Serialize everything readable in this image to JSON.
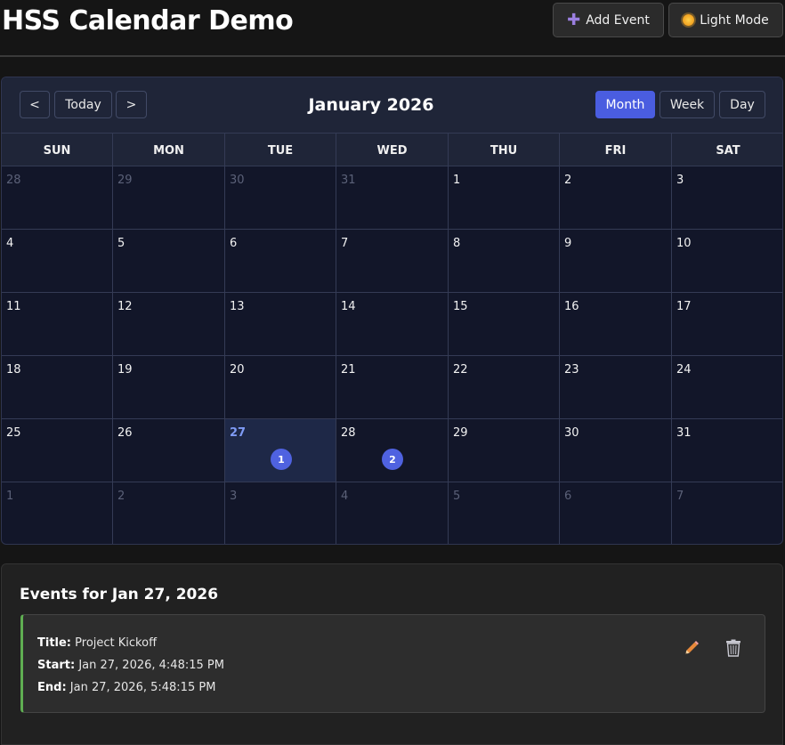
{
  "header": {
    "title": "HSS Calendar Demo",
    "add_event_label": "Add Event",
    "theme_label": "Light Mode"
  },
  "toolbar": {
    "prev_label": "<",
    "today_label": "Today",
    "next_label": ">",
    "title": "January 2026",
    "views": [
      "Month",
      "Week",
      "Day"
    ],
    "active_view": "Month"
  },
  "weekdays": [
    "SUN",
    "MON",
    "TUE",
    "WED",
    "THU",
    "FRI",
    "SAT"
  ],
  "weeks": [
    [
      {
        "d": "28",
        "other": true
      },
      {
        "d": "29",
        "other": true
      },
      {
        "d": "30",
        "other": true
      },
      {
        "d": "31",
        "other": true
      },
      {
        "d": "1"
      },
      {
        "d": "2"
      },
      {
        "d": "3"
      }
    ],
    [
      {
        "d": "4"
      },
      {
        "d": "5"
      },
      {
        "d": "6"
      },
      {
        "d": "7"
      },
      {
        "d": "8"
      },
      {
        "d": "9"
      },
      {
        "d": "10"
      }
    ],
    [
      {
        "d": "11"
      },
      {
        "d": "12"
      },
      {
        "d": "13"
      },
      {
        "d": "14"
      },
      {
        "d": "15"
      },
      {
        "d": "16"
      },
      {
        "d": "17"
      }
    ],
    [
      {
        "d": "18"
      },
      {
        "d": "19"
      },
      {
        "d": "20"
      },
      {
        "d": "21"
      },
      {
        "d": "22"
      },
      {
        "d": "23"
      },
      {
        "d": "24"
      }
    ],
    [
      {
        "d": "25"
      },
      {
        "d": "26"
      },
      {
        "d": "27",
        "today": true,
        "selected": true,
        "badge": "1"
      },
      {
        "d": "28",
        "badge": "2"
      },
      {
        "d": "29"
      },
      {
        "d": "30"
      },
      {
        "d": "31"
      }
    ],
    [
      {
        "d": "1",
        "other": true
      },
      {
        "d": "2",
        "other": true
      },
      {
        "d": "3",
        "other": true
      },
      {
        "d": "4",
        "other": true
      },
      {
        "d": "5",
        "other": true
      },
      {
        "d": "6",
        "other": true
      },
      {
        "d": "7",
        "other": true
      }
    ]
  ],
  "events_panel": {
    "heading": "Events for Jan 27, 2026",
    "event": {
      "title_label": "Title:",
      "title": "Project Kickoff",
      "start_label": "Start:",
      "start": "Jan 27, 2026, 4:48:15 PM",
      "end_label": "End:",
      "end": "Jan 27, 2026, 5:48:15 PM"
    },
    "edit_icon": "pencil-icon",
    "delete_icon": "trash-icon"
  },
  "colors": {
    "accent": "#4a5de0",
    "event_border": "#5fae52",
    "today_text": "#7f9bf5"
  }
}
